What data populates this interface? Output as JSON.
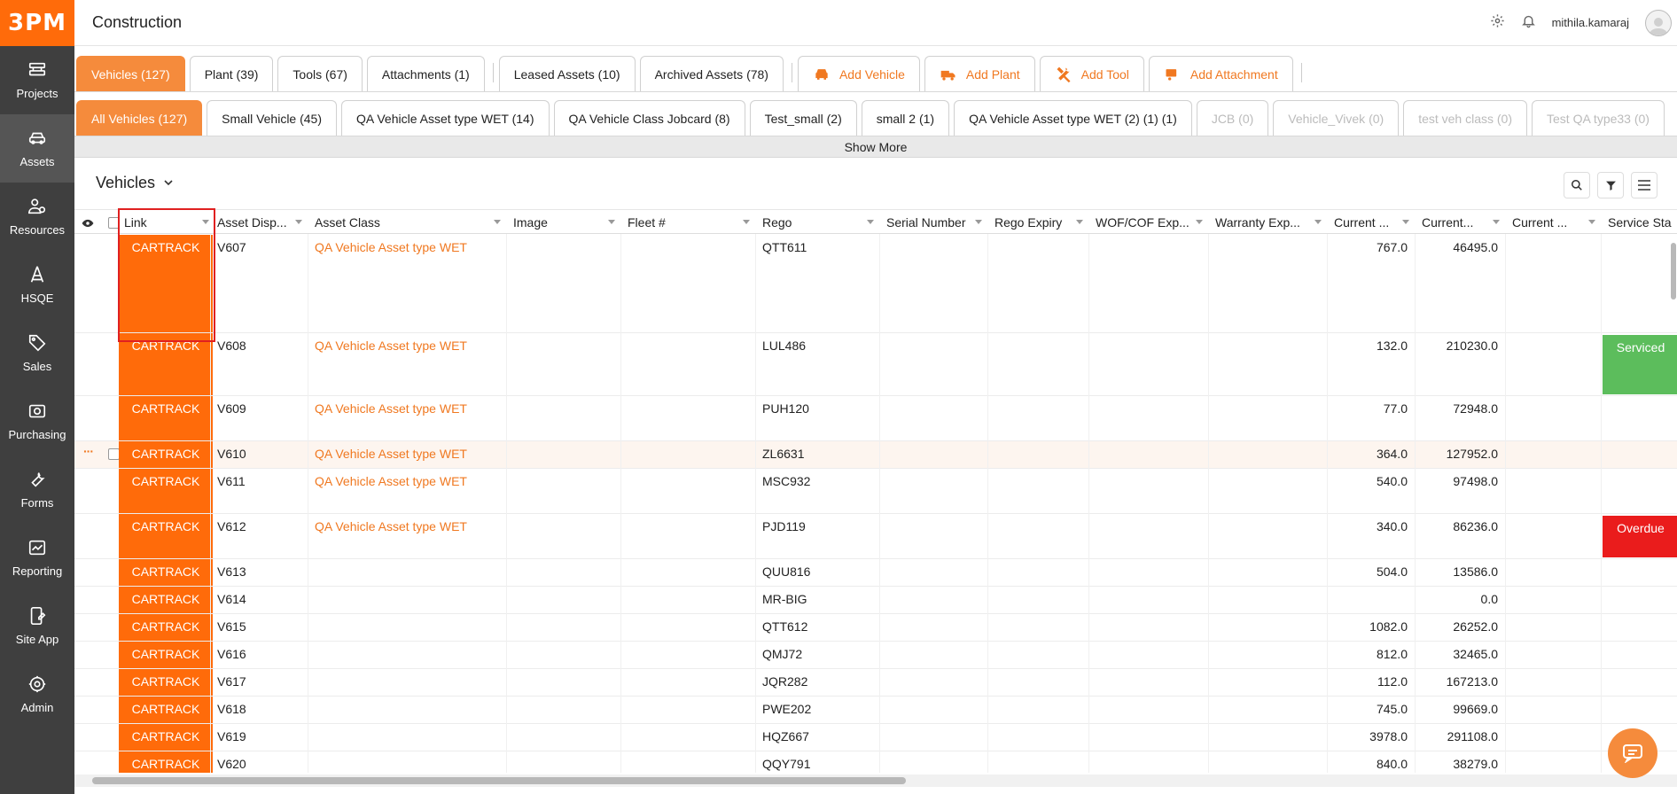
{
  "brand": {
    "logo_text": "3PM",
    "accent": "#ff6b0a"
  },
  "topbar": {
    "title": "Construction",
    "user": "mithila.kamaraj"
  },
  "sidebar": {
    "items": [
      {
        "label": "Projects",
        "icon": "projects-icon"
      },
      {
        "label": "Assets",
        "icon": "car-icon",
        "active": true
      },
      {
        "label": "Resources",
        "icon": "people-icon"
      },
      {
        "label": "HSQE",
        "icon": "hsqe-icon"
      },
      {
        "label": "Sales",
        "icon": "tag-icon"
      },
      {
        "label": "Purchasing",
        "icon": "eye-money-icon"
      },
      {
        "label": "Forms",
        "icon": "wrench-icon"
      },
      {
        "label": "Reporting",
        "icon": "chart-icon"
      },
      {
        "label": "Site App",
        "icon": "phone-edit-icon"
      },
      {
        "label": "Admin",
        "icon": "gear-icon"
      }
    ]
  },
  "asset_tabs": [
    {
      "label": "Vehicles (127)",
      "active": true
    },
    {
      "label": "Plant (39)"
    },
    {
      "label": "Tools (67)"
    },
    {
      "label": "Attachments (1)"
    },
    {
      "label": "Leased Assets (10)"
    },
    {
      "label": "Archived Assets (78)"
    }
  ],
  "add_actions": [
    {
      "label": "Add Vehicle",
      "icon": "car-icon"
    },
    {
      "label": "Add Plant",
      "icon": "truck-icon"
    },
    {
      "label": "Add Tool",
      "icon": "tools-icon"
    },
    {
      "label": "Add Attachment",
      "icon": "trailer-icon"
    }
  ],
  "class_tabs": [
    {
      "label": "All Vehicles (127)",
      "active": true
    },
    {
      "label": "Small Vehicle (45)"
    },
    {
      "label": "QA Vehicle Asset type WET (14)"
    },
    {
      "label": "QA Vehicle Class Jobcard (8)"
    },
    {
      "label": "Test_small (2)"
    },
    {
      "label": "small 2 (1)"
    },
    {
      "label": "QA Vehicle Asset type WET (2) (1) (1)"
    },
    {
      "label": "JCB (0)",
      "disabled": true
    },
    {
      "label": "Vehicle_Vivek (0)",
      "disabled": true
    },
    {
      "label": "test veh class (0)",
      "disabled": true
    },
    {
      "label": "Test QA type33 (0)",
      "disabled": true
    }
  ],
  "show_more": "Show More",
  "grid": {
    "title": "Vehicles",
    "columns": [
      "Link",
      "Asset Disp...",
      "Asset Class",
      "Image",
      "Fleet #",
      "Rego",
      "Serial Number",
      "Rego Expiry",
      "WOF/COF Exp...",
      "Warranty Exp...",
      "Current ...",
      "Current...",
      "Current ...",
      "Service Sta"
    ],
    "rows": [
      {
        "link": "CARTRACK",
        "disp": "V607",
        "class": "QA Vehicle Asset type WET",
        "rego": "QTT611",
        "c1": "767.0",
        "c2": "46495.0",
        "status": ""
      },
      {
        "link": "CARTRACK",
        "disp": "V608",
        "class": "QA Vehicle Asset type WET",
        "rego": "LUL486",
        "c1": "132.0",
        "c2": "210230.0",
        "status": "Serviced"
      },
      {
        "link": "CARTRACK",
        "disp": "V609",
        "class": "QA Vehicle Asset type WET",
        "rego": "PUH120",
        "c1": "77.0",
        "c2": "72948.0",
        "status": ""
      },
      {
        "link": "CARTRACK",
        "disp": "V610",
        "class": "QA Vehicle Asset type WET",
        "rego": "ZL6631",
        "c1": "364.0",
        "c2": "127952.0",
        "status": ""
      },
      {
        "link": "CARTRACK",
        "disp": "V611",
        "class": "QA Vehicle Asset type WET",
        "rego": "MSC932",
        "c1": "540.0",
        "c2": "97498.0",
        "status": ""
      },
      {
        "link": "CARTRACK",
        "disp": "V612",
        "class": "QA Vehicle Asset type WET",
        "rego": "PJD119",
        "c1": "340.0",
        "c2": "86236.0",
        "status": "Overdue"
      },
      {
        "link": "CARTRACK",
        "disp": "V613",
        "class": "",
        "rego": "QUU816",
        "c1": "504.0",
        "c2": "13586.0",
        "status": ""
      },
      {
        "link": "CARTRACK",
        "disp": "V614",
        "class": "",
        "rego": "MR-BIG",
        "c1": "",
        "c2": "0.0",
        "status": ""
      },
      {
        "link": "CARTRACK",
        "disp": "V615",
        "class": "",
        "rego": "QTT612",
        "c1": "1082.0",
        "c2": "26252.0",
        "status": ""
      },
      {
        "link": "CARTRACK",
        "disp": "V616",
        "class": "",
        "rego": "QMJ72",
        "c1": "812.0",
        "c2": "32465.0",
        "status": ""
      },
      {
        "link": "CARTRACK",
        "disp": "V617",
        "class": "",
        "rego": "JQR282",
        "c1": "112.0",
        "c2": "167213.0",
        "status": ""
      },
      {
        "link": "CARTRACK",
        "disp": "V618",
        "class": "",
        "rego": "PWE202",
        "c1": "745.0",
        "c2": "99669.0",
        "status": ""
      },
      {
        "link": "CARTRACK",
        "disp": "V619",
        "class": "",
        "rego": "HQZ667",
        "c1": "3978.0",
        "c2": "291108.0",
        "status": ""
      },
      {
        "link": "CARTRACK",
        "disp": "V620",
        "class": "",
        "rego": "QQY791",
        "c1": "840.0",
        "c2": "38279.0",
        "status": ""
      }
    ]
  },
  "colors": {
    "serviced": "#5cbd5c",
    "overdue": "#ea1c1c",
    "sidebar": "#3f3f3f"
  }
}
